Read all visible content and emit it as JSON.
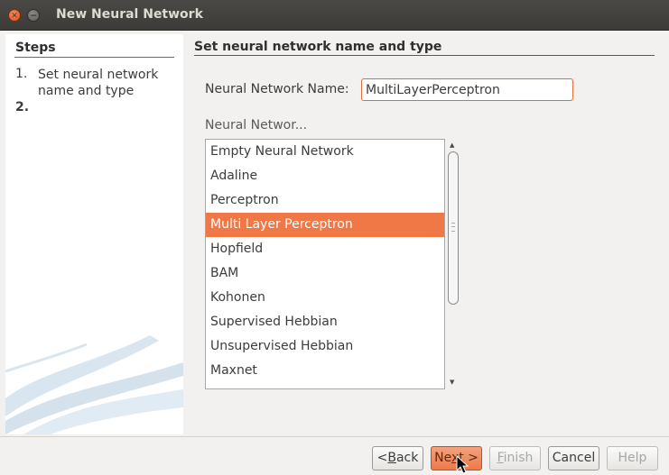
{
  "window": {
    "title": "New Neural Network"
  },
  "steps": {
    "heading": "Steps",
    "items": [
      {
        "num": "1.",
        "label": "Set neural network name and type"
      },
      {
        "num": "2.",
        "label": ""
      }
    ]
  },
  "main": {
    "heading": "Set neural network name and type",
    "name_label": "Neural Network Name:",
    "name_value": "MultiLayerPerceptron",
    "type_label": "Neural Networ...",
    "types": [
      "Empty Neural Network",
      "Adaline",
      "Perceptron",
      "Multi Layer Perceptron",
      "Hopfield",
      "BAM",
      "Kohonen",
      "Supervised Hebbian",
      "Unsupervised Hebbian",
      "Maxnet"
    ],
    "selected_type": "Multi Layer Perceptron"
  },
  "buttons": {
    "back_prefix": "<",
    "back_mnemonic": "B",
    "back_rest": "ack",
    "next_prefix": "Ne",
    "next_mnemonic": "x",
    "next_rest": "t >",
    "finish_mnemonic": "F",
    "finish_rest": "inish",
    "cancel": "Cancel",
    "help": "Help"
  },
  "colors": {
    "accent": "#f07746",
    "titlebar": "#3c3b37"
  }
}
